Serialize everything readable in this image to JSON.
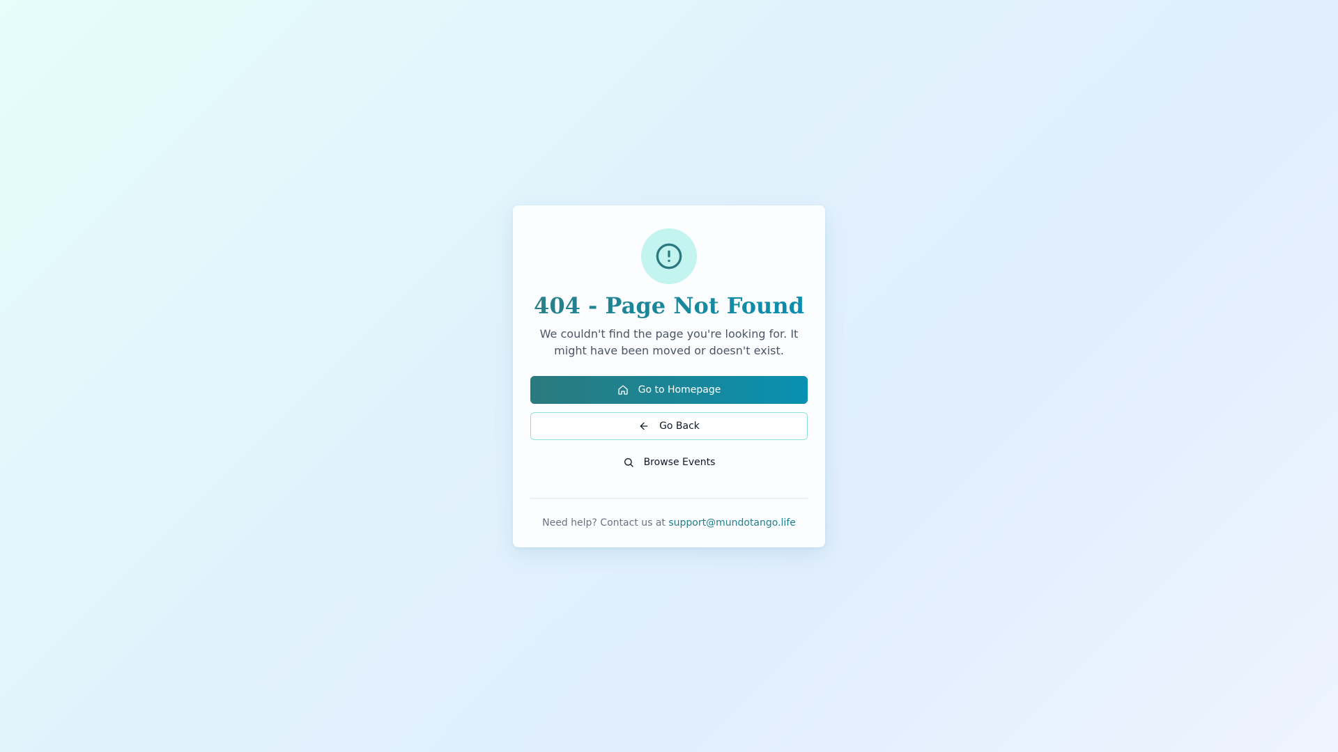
{
  "error": {
    "icon": "alert-circle-icon",
    "title": "404 - Page Not Found",
    "description": "We couldn't find the page you're looking for. It might have been moved or doesn't exist."
  },
  "actions": {
    "homepage": {
      "label": "Go to Homepage",
      "icon": "home-icon"
    },
    "back": {
      "label": "Go Back",
      "icon": "arrow-left-icon"
    },
    "browse": {
      "label": "Browse Events",
      "icon": "search-icon"
    }
  },
  "help": {
    "text": "Need help? Contact us at",
    "email": "support@mundotango.life"
  },
  "colors": {
    "accent": "#1f8a99",
    "icon_bg": "#c3f4f0",
    "primary_start": "#2a7a7d",
    "primary_end": "#0891b2",
    "outline_border": "#8fdfdc",
    "link": "#1f7f8a"
  }
}
